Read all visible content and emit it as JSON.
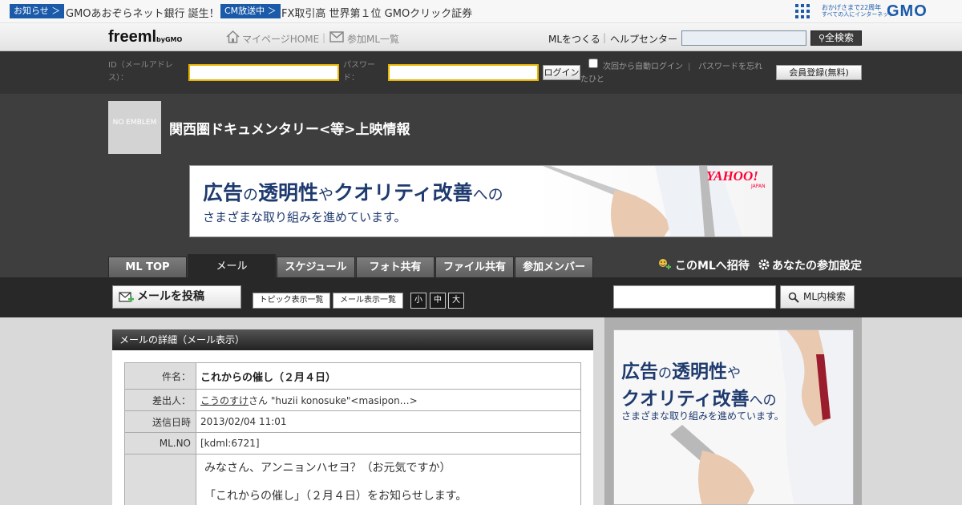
{
  "newsbar": {
    "badge1": "お知らせ ＞",
    "news1": "GMOあおぞらネット銀行 誕生！",
    "badge2": "CM放送中 ＞",
    "news2": "FX取引高 世界第１位 GMOクリック証券",
    "gmo_tagline1": "おかげさまで22周年",
    "gmo_tagline2": "すべての人にインターネット",
    "gmo_logo": "GMO"
  },
  "nav": {
    "logo": "freeml",
    "logo_by": "byGMO",
    "mypage": "マイページHOME",
    "joined": "参加ML一覧",
    "create": "MLをつくる",
    "help": "ヘルプセンター",
    "search_btn": "全検索",
    "search_value": ""
  },
  "login": {
    "id_label": "ID（メールアドレス）：",
    "pw_label": "パスワード：",
    "login_btn": "ログイン",
    "auto_login": "次回から自動ログイン",
    "forgot": "パスワードを忘れたひと",
    "register_btn": "会員登録(無料)"
  },
  "header": {
    "emblem_text": "NO EMBLEM",
    "ml_title": "関西圏ドキュメンタリー<等>上映情報",
    "invite": "このMLへ招待",
    "settings": "あなたの参加設定"
  },
  "ad": {
    "line1_a": "広告",
    "line1_b": "の",
    "line1_c": "透明性",
    "line1_d": "や",
    "line1_e": "クオリティ改善",
    "line1_f": "への",
    "line2": "さまざまな取り組みを進めています。",
    "brand": "YAHOO!",
    "brand_sub": "JAPAN"
  },
  "tabs": [
    "ML TOP",
    "メール",
    "スケジュール",
    "フォト共有",
    "ファイル共有",
    "参加メンバー"
  ],
  "toolbar": {
    "post": "メールを投稿",
    "topic_view": "トピック表示一覧",
    "mail_view": "メール表示一覧",
    "size_small": "小",
    "size_mid": "中",
    "size_large": "大",
    "search_btn": "ML内検索",
    "search_value": ""
  },
  "detail": {
    "heading": "メールの詳細（メール表示）",
    "subject_label": "件名：",
    "subject": "これからの催し（２月４日）",
    "sender_label": "差出人：",
    "sender_name": "こうのすけ",
    "sender_suffix": "さん \"huzii konosuke\"<masipon…>",
    "date_label": "送信日時",
    "date": "2013/02/04 11:01",
    "mlno_label": "ML.NO",
    "mlno": "[kdml:6721]",
    "body_line1": "みなさん、アンニョンハセヨ？（お元気ですか）",
    "body_line2": "「これからの催し」（２月４日）をお知らせします。"
  },
  "side_ad": {
    "line1_a": "広告",
    "line1_b": "の",
    "line1_c": "透明性",
    "line1_d": "や",
    "line2_a": "クオリティ改善",
    "line2_b": "への",
    "line3": "さまざまな取り組みを進めています。"
  },
  "colors": {
    "news_badge": "#1a5aa8",
    "ad_blue": "#1e3a6e",
    "header_bg": "#3e3e3e",
    "yahoo_red": "#ff0033"
  }
}
